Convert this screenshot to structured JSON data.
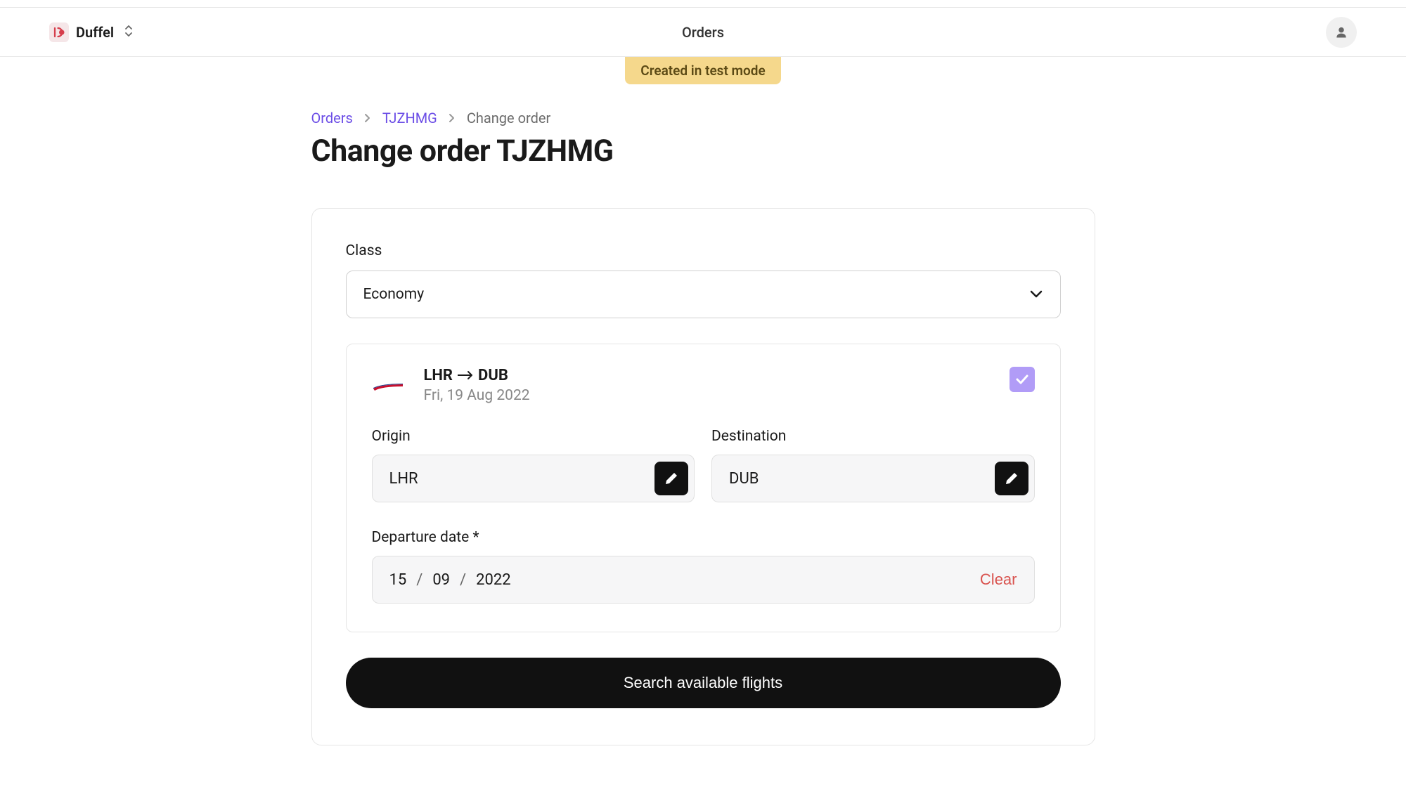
{
  "header": {
    "brand": "Duffel",
    "nav_title": "Orders"
  },
  "test_mode_banner": "Created in test mode",
  "breadcrumb": {
    "orders": "Orders",
    "order_id": "TJZHMG",
    "current": "Change order"
  },
  "page_title": "Change order TJZHMG",
  "form": {
    "class_label": "Class",
    "class_value": "Economy",
    "route": {
      "origin_code": "LHR",
      "dest_code": "DUB",
      "date_text": "Fri, 19 Aug 2022",
      "selected": true
    },
    "origin_label": "Origin",
    "origin_value": "LHR",
    "destination_label": "Destination",
    "destination_value": "DUB",
    "departure_label": "Departure date *",
    "departure_day": "15",
    "departure_month": "09",
    "departure_year": "2022",
    "clear_label": "Clear",
    "search_label": "Search available flights"
  }
}
